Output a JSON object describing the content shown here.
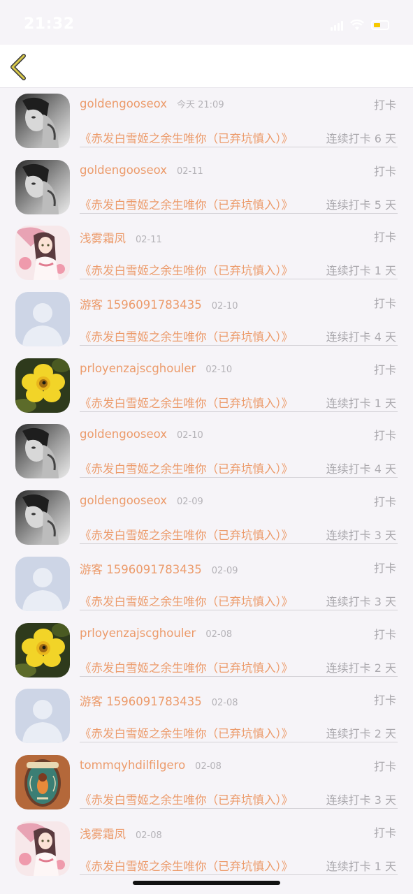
{
  "status_bar": {
    "time": "21:32"
  },
  "colors": {
    "accent": "#ec9b6b",
    "muted": "#aaa8ad",
    "background": "#f6f4f8",
    "back_arrow": "#d8c84a"
  },
  "items": [
    {
      "avatar": "grayscale-portrait",
      "name": "goldengooseox",
      "date": "今天 21:09",
      "tag": "打卡",
      "book": "《赤发白雪姬之余生唯你（已弃坑慎入）》",
      "streak": "连续打卡 6 天"
    },
    {
      "avatar": "grayscale-portrait",
      "name": "goldengooseox",
      "date": "02-11",
      "tag": "打卡",
      "book": "《赤发白雪姬之余生唯你（已弃坑慎入）》",
      "streak": "连续打卡 5 天"
    },
    {
      "avatar": "anime-girl-umbrella",
      "name": "浅雾霜凤",
      "date": "02-11",
      "tag": "打卡",
      "book": "《赤发白雪姬之余生唯你（已弃坑慎入）》",
      "streak": "连续打卡 1 天"
    },
    {
      "avatar": "default-user",
      "name": "游客 1596091783435",
      "date": "02-10",
      "tag": "打卡",
      "book": "《赤发白雪姬之余生唯你（已弃坑慎入）》",
      "streak": "连续打卡 4 天"
    },
    {
      "avatar": "yellow-flower",
      "name": "prloyenzajscghouler",
      "date": "02-10",
      "tag": "打卡",
      "book": "《赤发白雪姬之余生唯你（已弃坑慎入）》",
      "streak": "连续打卡 1 天"
    },
    {
      "avatar": "grayscale-portrait",
      "name": "goldengooseox",
      "date": "02-10",
      "tag": "打卡",
      "book": "《赤发白雪姬之余生唯你（已弃坑慎入）》",
      "streak": "连续打卡 4 天"
    },
    {
      "avatar": "grayscale-portrait",
      "name": "goldengooseox",
      "date": "02-09",
      "tag": "打卡",
      "book": "《赤发白雪姬之余生唯你（已弃坑慎入）》",
      "streak": "连续打卡 3 天"
    },
    {
      "avatar": "default-user",
      "name": "游客 1596091783435",
      "date": "02-09",
      "tag": "打卡",
      "book": "《赤发白雪姬之余生唯你（已弃坑慎入）》",
      "streak": "连续打卡 3 天"
    },
    {
      "avatar": "yellow-flower",
      "name": "prloyenzajscghouler",
      "date": "02-08",
      "tag": "打卡",
      "book": "《赤发白雪姬之余生唯你（已弃坑慎入）》",
      "streak": "连续打卡 2 天"
    },
    {
      "avatar": "default-user",
      "name": "游客 1596091783435",
      "date": "02-08",
      "tag": "打卡",
      "book": "《赤发白雪姬之余生唯你（已弃坑慎入）》",
      "streak": "连续打卡 2 天"
    },
    {
      "avatar": "vintage-bird-label",
      "name": "tommqyhdilfilgero",
      "date": "02-08",
      "tag": "打卡",
      "book": "《赤发白雪姬之余生唯你（已弃坑慎入）》",
      "streak": "连续打卡 3 天"
    },
    {
      "avatar": "anime-girl-umbrella",
      "name": "浅雾霜凤",
      "date": "02-08",
      "tag": "打卡",
      "book": "《赤发白雪姬之余生唯你（已弃坑慎入）》",
      "streak": "连续打卡 1 天"
    }
  ]
}
